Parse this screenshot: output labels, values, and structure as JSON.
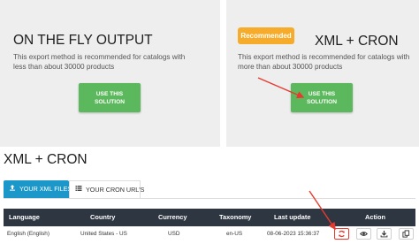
{
  "cards": {
    "on_the_fly": {
      "title": "ON THE FLY OUTPUT",
      "desc_line1": "This export method is recommended for catalogs with",
      "desc_line2": "less than about 30000 products",
      "button_line1": "USE THIS",
      "button_line2": "SOLUTION"
    },
    "xml_cron": {
      "badge": "Recommended",
      "title": "XML + CRON",
      "desc_line1": "This export method is recommended for catalogs with",
      "desc_line2": "more than about 30000 products",
      "button_line1": "USE THIS",
      "button_line2": "SOLUTION"
    }
  },
  "section": {
    "heading": "XML + CRON"
  },
  "tabs": [
    {
      "label": "YOUR XML FILES",
      "active": true
    },
    {
      "label": "YOUR CRON URL'S",
      "active": false
    }
  ],
  "table": {
    "headers": [
      "Language",
      "Country",
      "Currency",
      "Taxonomy",
      "Last update",
      "Action"
    ],
    "rows": [
      {
        "language": "English (English)",
        "country": "United States - US",
        "currency": "USD",
        "taxonomy": "en-US",
        "last_update": "08-06-2023 15:36:37"
      }
    ]
  },
  "colors": {
    "card_bg": "#eeeeef",
    "use_button": "#5cb85c",
    "badge": "#f6ac2a",
    "active_tab": "#1c97c9",
    "table_header": "#2d3641",
    "annotation_arrow": "#e8392f"
  },
  "icons": {
    "xml_tab": "upload-icon",
    "cron_tab": "list-icon",
    "actions": [
      "refresh-icon",
      "eye-icon",
      "download-icon",
      "copy-icon"
    ]
  }
}
